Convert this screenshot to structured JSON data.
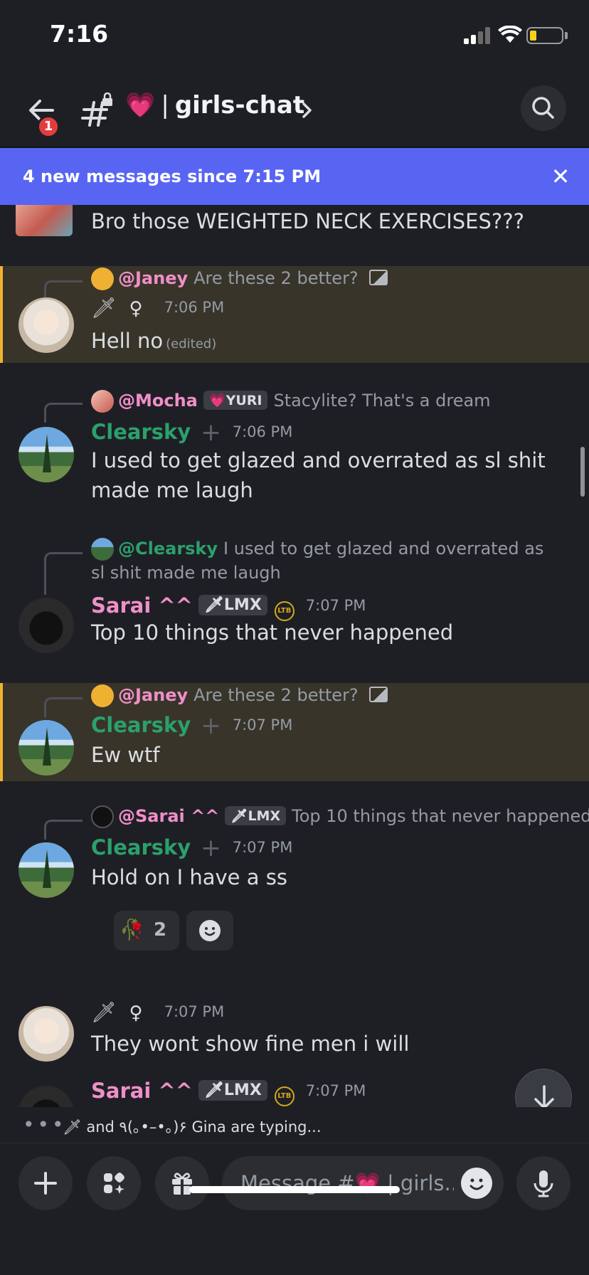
{
  "status_bar": {
    "time": "7:16"
  },
  "header": {
    "back_badge": "1",
    "channel_emoji": "💗",
    "channel_name": "girls-chat"
  },
  "banner": {
    "text": "4 new messages since 7:15 PM",
    "close": "✕"
  },
  "colors": {
    "accent": "#5865f2",
    "highlight_bar": "#f0b132",
    "pink_name": "#ef8fc8",
    "green_name": "#2ba06c"
  },
  "messages": [
    {
      "id": "m0",
      "text": "Bro those WEIGHTED NECK EXERCISES???"
    },
    {
      "id": "m1",
      "highlighted": true,
      "reply": {
        "who": "@Janey",
        "text": "Are these 2 better?"
      },
      "time": "7:06 PM",
      "text": "Hell no",
      "edited": "(edited)"
    },
    {
      "id": "m2",
      "reply": {
        "who": "@Mocha",
        "tag": "YURI",
        "text": "Stacylite? That's a dream"
      },
      "author": "Clearsky",
      "time": "7:06 PM",
      "text": "I used to get glazed and overrated as sl shit made me laugh"
    },
    {
      "id": "m3",
      "reply": {
        "who": "@Clearsky",
        "text": "I used to get glazed and overrated as sl shit made me laugh"
      },
      "author": "Sarai ^^",
      "tag": "LMX",
      "badge": "LTB",
      "time": "7:07 PM",
      "text": "Top 10 things that never happened"
    },
    {
      "id": "m4",
      "highlighted": true,
      "reply": {
        "who": "@Janey",
        "text": "Are these 2 better?"
      },
      "author": "Clearsky",
      "time": "7:07 PM",
      "text": "Ew wtf"
    },
    {
      "id": "m5",
      "reply": {
        "who": "@Sarai ^^",
        "tag": "LMX",
        "text": "Top 10 things that never happened"
      },
      "author": "Clearsky",
      "time": "7:07 PM",
      "text": "Hold on I have a ss",
      "reaction": {
        "emoji": "🥀",
        "count": "2"
      }
    },
    {
      "id": "m6",
      "time": "7:07 PM",
      "text": "They wont show fine men i will"
    },
    {
      "id": "m7",
      "author": "Sarai ^^",
      "tag": "LMX",
      "badge": "LTB",
      "time": "7:07 PM"
    }
  ],
  "typing": {
    "text": "and ٩(｡•–•｡)۶ Gina are typing..."
  },
  "composer": {
    "placeholder": "Message #💗 | girls..."
  },
  "icons": [
    "back-arrow-icon",
    "channel-hash-lock-icon",
    "chevron-right-icon",
    "search-icon",
    "close-icon",
    "plus-icon",
    "apps-icon",
    "gift-icon",
    "emoji-icon",
    "microphone-icon",
    "arrow-down-icon"
  ]
}
